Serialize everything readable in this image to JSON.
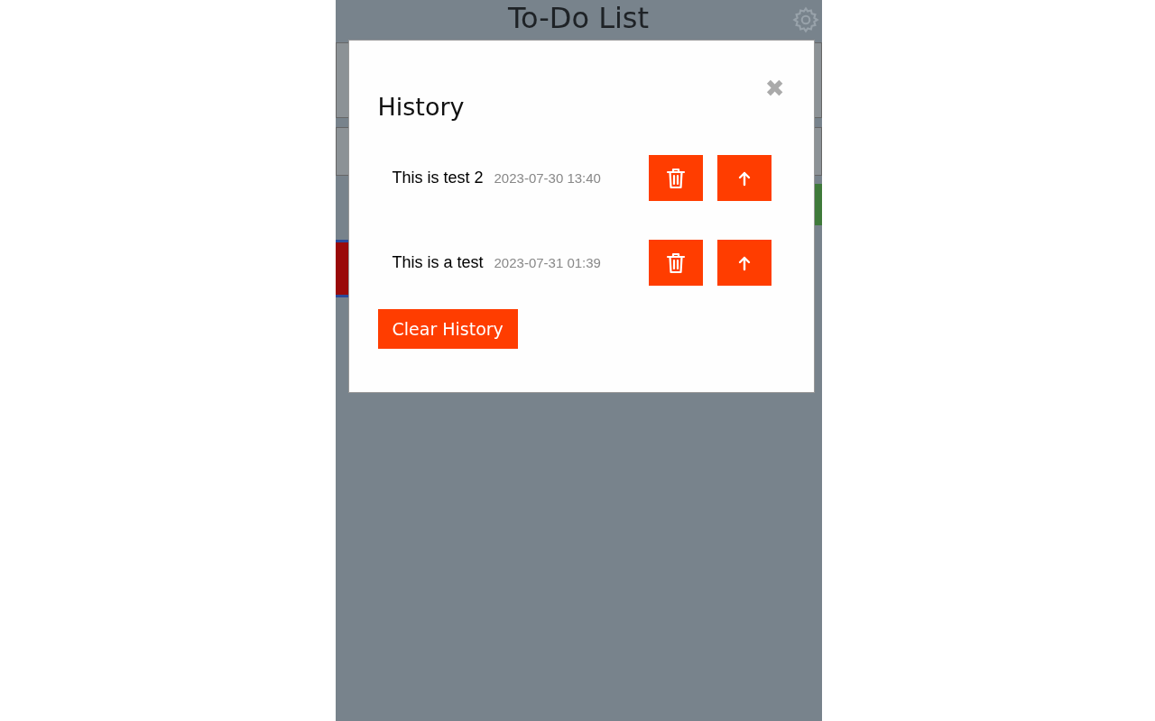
{
  "app": {
    "title": "To-Do List"
  },
  "dialog": {
    "title": "History",
    "close_label": "✖",
    "items": [
      {
        "text": "This is test 2",
        "time": "2023-07-30 13:40"
      },
      {
        "text": "This is a test",
        "time": "2023-07-31 01:39"
      }
    ],
    "clear_button": "Clear History"
  }
}
